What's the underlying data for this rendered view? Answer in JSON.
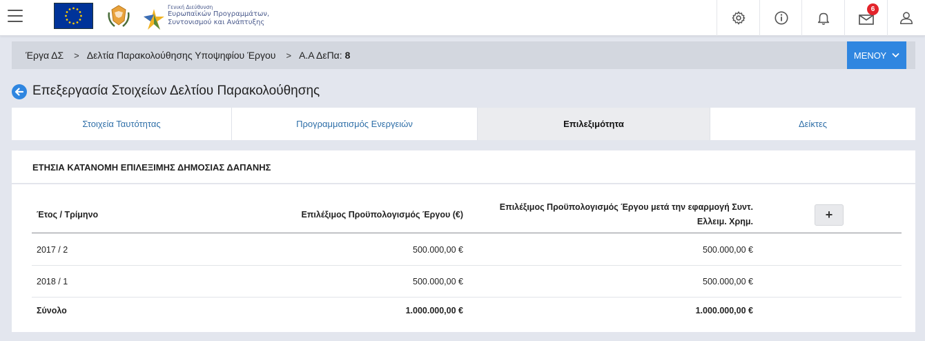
{
  "header": {
    "logo_text": {
      "line1": "Γενική Διεύθυνση",
      "line2": "Ευρωπαϊκών Προγραμμάτων,",
      "line3": "Συντονισμού και Ανάπτυξης"
    },
    "icons": [
      "settings-icon",
      "info-icon",
      "bell-icon",
      "mail-icon",
      "user-icon"
    ],
    "mail_badge": "6"
  },
  "breadcrumb": {
    "item1": "Έργα ΔΣ",
    "item2": "Δελτία Παρακολούθησης Υποψηφίου Έργου",
    "item3_label": "Α.Α ΔεΠα:",
    "item3_value": "8",
    "menu_label": "ΜΕΝΟΥ"
  },
  "page": {
    "title": "Επεξεργασία Στοιχείων Δελτίου Παρακολούθησης"
  },
  "tabs": [
    {
      "label": "Στοιχεία Ταυτότητας",
      "active": false
    },
    {
      "label": "Προγραμματισμός Ενεργειών",
      "active": false
    },
    {
      "label": "Επιλεξιμότητα",
      "active": true
    },
    {
      "label": "Δείκτες",
      "active": false
    }
  ],
  "section": {
    "title": "ΕΤΗΣΙΑ ΚΑΤΑΝΟΜΗ ΕΠΙΛΕΞΙΜΗΣ ΔΗΜΟΣΙΑΣ ΔΑΠΑΝΗΣ",
    "columns": {
      "year": "Έτος / Τρίμηνο",
      "budget": "Επιλέξιμος Προϋπολογισμός Έργου (€)",
      "budget_after_line1": "Επιλέξιμος Προϋπολογισμός Έργου μετά την εφαρμογή Συντ.",
      "budget_after_line2": "Ελλειμ. Χρημ."
    },
    "add_label": "+",
    "rows": [
      {
        "period": "2017 / 2",
        "budget": "500.000,00 €",
        "budget_after": "500.000,00 €"
      },
      {
        "period": "2018 / 1",
        "budget": "500.000,00 €",
        "budget_after": "500.000,00 €"
      }
    ],
    "total": {
      "label": "Σύνολο",
      "budget": "1.000.000,00 €",
      "budget_after": "1.000.000,00 €"
    }
  },
  "colors": {
    "accent": "#2f86e0",
    "badge": "#e3242b",
    "link": "#2f6fa8"
  }
}
